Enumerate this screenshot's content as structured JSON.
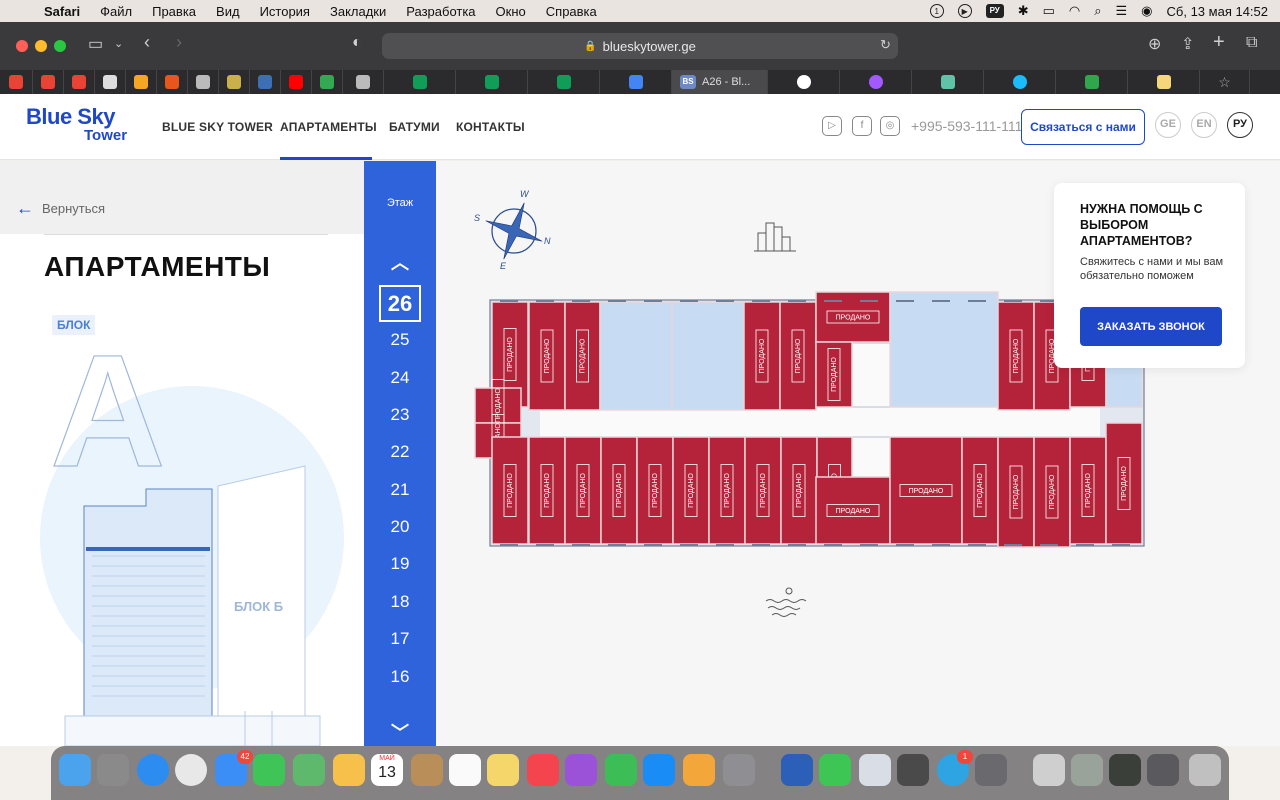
{
  "menubar": {
    "app": "Safari",
    "items": [
      "Файл",
      "Правка",
      "Вид",
      "История",
      "Закладки",
      "Разработка",
      "Окно",
      "Справка"
    ],
    "input_source": "РУ",
    "datetime": "Сб, 13 мая  14:52"
  },
  "browser": {
    "url": "blueskytower.ge",
    "active_tab": {
      "badge": "BS",
      "label": "A26 - Bl..."
    }
  },
  "site": {
    "logo_line1": "Blue Sky",
    "logo_line2": "Tower",
    "nav": [
      "BLUE SKY TOWER",
      "АПАРТАМЕНТЫ",
      "БАТУМИ",
      "КОНТАКТЫ"
    ],
    "phone": "+995-593-111-111",
    "contact_button": "Связаться с нами",
    "langs": [
      "GE",
      "EN",
      "РУ"
    ]
  },
  "left": {
    "back_label": "Вернуться",
    "title": "АПАРТАМЕНТЫ",
    "block_a_tag": "БЛОК",
    "block_a_letter": "A",
    "block_b_label": "БЛОК Б"
  },
  "floors": {
    "label": "Этаж",
    "current": "26",
    "list": [
      "25",
      "24",
      "23",
      "22",
      "21",
      "20",
      "19",
      "18",
      "17",
      "16"
    ]
  },
  "plan": {
    "compass": [
      "W",
      "N",
      "E",
      "S"
    ],
    "sold_label": "ПРОДАНО",
    "sold_color": "#b5233a",
    "free_color": "#c7dcf3"
  },
  "help": {
    "title": "НУЖНА ПОМОЩЬ С ВЫБОРОМ АПАРТАМЕНТОВ?",
    "text": "Свяжитесь с нами и мы вам обязательно поможем",
    "button": "ЗАКАЗАТЬ ЗВОНОК"
  },
  "dock": {
    "mail_badge": "42",
    "calendar_month": "МАЙ",
    "calendar_day": "13",
    "telegram_badge": "1"
  }
}
